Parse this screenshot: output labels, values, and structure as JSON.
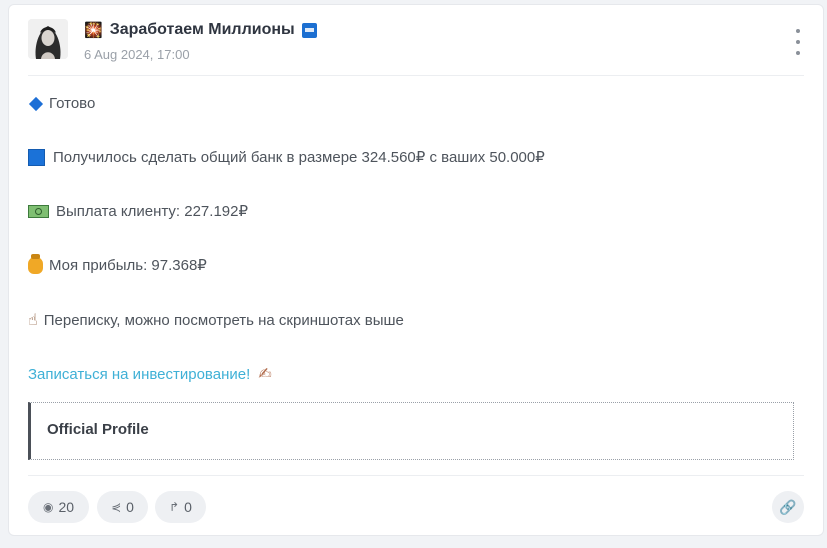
{
  "post": {
    "channel_emoji": "🎇",
    "channel_name": "Заработаем Миллионы",
    "date": "6 Aug 2024, 17:00",
    "lines": {
      "l1": "Готово",
      "l2": "Получилось сделать общий банк в размере 324.560₽ с ваших 50.000₽",
      "l3": "Выплата клиенту: 227.192₽",
      "l4": "Моя прибыль: 97.368₽",
      "l5": "Переписку, можно посмотреть на скриншотах выше"
    },
    "link_text": "Записаться на инвестирование!",
    "quote_title": "Official Profile"
  },
  "footer": {
    "views": "20",
    "reactions": "0",
    "forwards": "0"
  },
  "icons": {
    "header_emoji": "sparkler-icon",
    "verified": "verified-badge-icon",
    "more": "more-vertical-icon",
    "diamond": "blue-diamond-icon",
    "square": "blue-square-icon",
    "bill": "banknote-icon",
    "bag": "money-bag-icon",
    "hand": "pointing-hand-icon",
    "pen": "writing-hand-icon",
    "eye": "eye-icon",
    "share": "share-icon",
    "forward": "forward-icon",
    "link": "link-icon"
  },
  "colors": {
    "link": "#3fb0d6",
    "accent_blue": "#1b72d8"
  }
}
